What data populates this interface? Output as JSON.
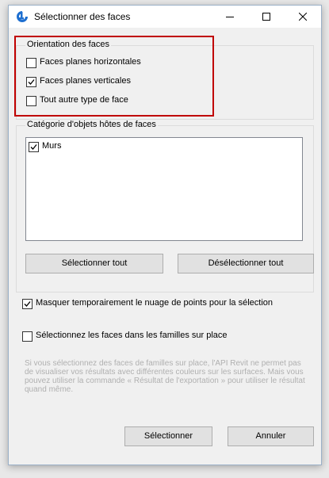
{
  "window": {
    "title": "Sélectionner des faces"
  },
  "orientation": {
    "title": "Orientation des faces",
    "options": [
      {
        "label": "Faces planes horizontales",
        "checked": false
      },
      {
        "label": "Faces planes verticales",
        "checked": true
      },
      {
        "label": "Tout autre type de face",
        "checked": false
      }
    ]
  },
  "category": {
    "title": "Catégorie d'objets hôtes de faces",
    "items": [
      {
        "label": "Murs",
        "checked": true
      }
    ],
    "select_all_label": "Sélectionner tout",
    "deselect_all_label": "Désélectionner tout"
  },
  "options": {
    "hide_point_cloud": {
      "label": "Masquer temporairement le nuage de points pour la sélection",
      "checked": true
    },
    "select_in_place_families": {
      "label": "Sélectionnez les faces dans les familles sur place",
      "checked": false
    }
  },
  "info_text": "Si vous sélectionnez des faces de familles sur place, l'API Revit ne permet pas de visualiser vos résultats avec différentes couleurs sur les surfaces. Mais vous pouvez utiliser la commande « Résultat de l'exportation » pour utiliser le résultat quand même.",
  "footer": {
    "select_label": "Sélectionner",
    "cancel_label": "Annuler"
  },
  "colors": {
    "highlight_border": "#c00000",
    "app_icon": "#1e6fd0"
  }
}
